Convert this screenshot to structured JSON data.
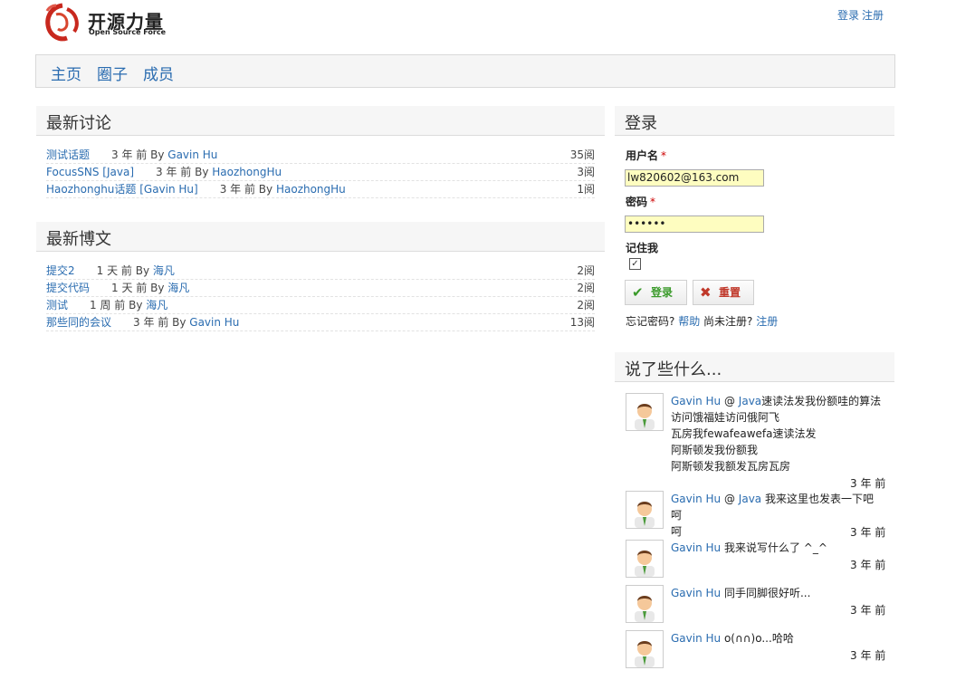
{
  "logo": {
    "cn": "开源力量",
    "en": "Open Source Force"
  },
  "top": {
    "login": "登录",
    "register": "注册"
  },
  "nav": [
    "主页",
    "圈子",
    "成员"
  ],
  "discussions": {
    "title": "最新讨论",
    "items": [
      {
        "title": "测试话题",
        "ago": "3 年 前 By",
        "author": "Gavin Hu",
        "reads": "35阅"
      },
      {
        "title": "FocusSNS [Java]",
        "ago": "3 年 前 By",
        "author": "HaozhongHu",
        "reads": "3阅"
      },
      {
        "title": "Haozhonghu话题 [Gavin Hu]",
        "ago": "3 年 前 By",
        "author": "HaozhongHu",
        "reads": "1阅"
      }
    ]
  },
  "posts": {
    "title": "最新博文",
    "items": [
      {
        "title": "提交2",
        "ago": "1 天 前 By",
        "author": "海凡",
        "reads": "2阅"
      },
      {
        "title": "提交代码",
        "ago": "1 天 前 By",
        "author": "海凡",
        "reads": "2阅"
      },
      {
        "title": "测试",
        "ago": "1 周 前 By",
        "author": "海凡",
        "reads": "2阅"
      },
      {
        "title": "那些同的会议",
        "ago": "3 年 前 By",
        "author": "Gavin Hu",
        "reads": "13阅"
      }
    ]
  },
  "login": {
    "title": "登录",
    "username_label": "用户名",
    "username_value": "lw820602@163.com",
    "password_label": "密码",
    "password_value": "••••••",
    "remember_label": "记住我",
    "remember_checked": "✓",
    "required_mark": "*",
    "submit_label": "登录",
    "reset_label": "重置",
    "forgot_text": "忘记密码?",
    "help_link": "帮助",
    "not_registered_text": "尚未注册?",
    "register_link": "注册"
  },
  "feed": {
    "title": "说了些什么...",
    "items": [
      {
        "user": "Gavin Hu",
        "at": "@",
        "target": "Java",
        "lines": [
          "速读法发我份额哇的算法",
          "访问饿福娃访问俄阿飞",
          "瓦房我fewafeawefa速读法发",
          "阿斯顿发我份额我",
          "阿斯顿发我额发瓦房瓦房"
        ],
        "ago": "3 年 前"
      },
      {
        "user": "Gavin Hu",
        "at": "@",
        "target": "Java",
        "lines": [
          "我来这里也发表一下吧 呵",
          "呵"
        ],
        "ago": "3 年 前"
      },
      {
        "user": "Gavin Hu",
        "at": "",
        "target": "",
        "lines": [
          "我来说写什么了 ^_^"
        ],
        "ago": "3 年 前"
      },
      {
        "user": "Gavin Hu",
        "at": "",
        "target": "",
        "lines": [
          "同手同脚很好听..."
        ],
        "ago": "3 年 前"
      },
      {
        "user": "Gavin Hu",
        "at": "",
        "target": "",
        "lines": [
          "o(∩∩)o...哈哈"
        ],
        "ago": "3 年 前"
      }
    ]
  },
  "colors": {
    "link": "#2a6cb0",
    "input_bg": "#fefdc0",
    "required": "#cc0000",
    "ok_green": "#3a9a2a",
    "reset_red": "#c0392b"
  },
  "icons": [
    "logo-swirl-icon",
    "check-icon",
    "cross-icon",
    "avatar-icon"
  ]
}
